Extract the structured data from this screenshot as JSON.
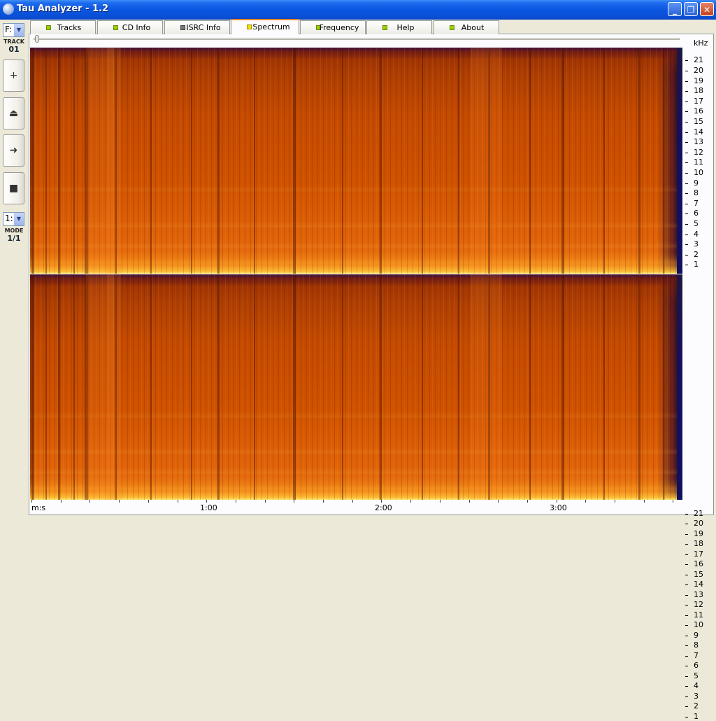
{
  "window": {
    "title": "Tau Analyzer - 1.2",
    "minimize_label": "_",
    "maximize_label": "❐",
    "close_label": "✕"
  },
  "sidebar": {
    "drive_value": "F:",
    "track_label": "TRACK",
    "track_value": "01",
    "buttons": [
      {
        "name": "zoom-in-button",
        "glyph": "+"
      },
      {
        "name": "eject-button",
        "glyph": "⏏"
      },
      {
        "name": "play-button",
        "glyph": "➜"
      },
      {
        "name": "stop-button",
        "glyph": "■"
      }
    ],
    "mode_select_value": "1:",
    "mode_label": "MODE",
    "mode_value": "1/1"
  },
  "tabs": [
    {
      "label": "Tracks",
      "active": false
    },
    {
      "label": "CD Info",
      "active": false
    },
    {
      "label": "ISRC Info",
      "active": false
    },
    {
      "label": "Spectrum",
      "active": true
    },
    {
      "label": "Frequency",
      "active": false
    },
    {
      "label": "Help",
      "active": false
    },
    {
      "label": "About",
      "active": false
    }
  ],
  "spectrum": {
    "frequency_unit": "kHz",
    "frequency_ticks": [
      "21",
      "20",
      "19",
      "18",
      "17",
      "16",
      "15",
      "14",
      "13",
      "12",
      "11",
      "10",
      "9",
      "8",
      "7",
      "6",
      "5",
      "4",
      "3",
      "2",
      "1"
    ],
    "time_axis_label": "m:s",
    "time_labels": [
      "1:00",
      "2:00",
      "3:00"
    ],
    "slider_position": 0.0,
    "colors": {
      "hot": "#ffe060",
      "mid": "#d45400",
      "cold": "#140e50"
    }
  }
}
